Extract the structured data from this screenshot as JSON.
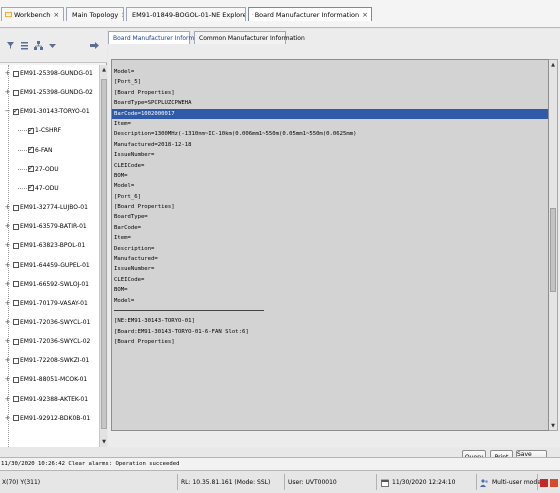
{
  "tabs": [
    {
      "label": "Workbench",
      "icon": "workbench-icon"
    },
    {
      "label": "Main Topology",
      "icon": "topology-icon"
    },
    {
      "label": "EM91-01849-BOGOL-01-NE Explorer]",
      "icon": "ne-explorer-icon"
    },
    {
      "label": "Board Manufacturer Information",
      "icon": "info-icon"
    }
  ],
  "left_toolbar": {
    "icons": [
      "filter-icon",
      "list-icon",
      "tree-icon",
      "dropdown-icon",
      "arrow-right-icon"
    ]
  },
  "tree": {
    "items": [
      {
        "label": "EM91-25398-GUNDG-01",
        "checked": false,
        "level": 0
      },
      {
        "label": "EM91-25398-GUNDG-02",
        "checked": false,
        "level": 0
      },
      {
        "label": "EM91-30143-TORYO-01",
        "checked": true,
        "level": 0
      },
      {
        "label": "1-CSHRF",
        "checked": true,
        "level": 1
      },
      {
        "label": "6-FAN",
        "checked": true,
        "level": 1
      },
      {
        "label": "27-ODU",
        "checked": true,
        "level": 1
      },
      {
        "label": "47-ODU",
        "checked": true,
        "level": 1
      },
      {
        "label": "EM91-32774-LUJBO-01",
        "checked": false,
        "level": 0
      },
      {
        "label": "EM91-63579-BATIR-01",
        "checked": false,
        "level": 0
      },
      {
        "label": "EM91-63823-BPOL-01",
        "checked": false,
        "level": 0
      },
      {
        "label": "EM91-64459-GUPEL-01",
        "checked": false,
        "level": 0
      },
      {
        "label": "EM91-66592-SWLOJ-01",
        "checked": false,
        "level": 0
      },
      {
        "label": "EM91-70179-VASAY-01",
        "checked": false,
        "level": 0
      },
      {
        "label": "EM91-72036-SWYCL-01",
        "checked": false,
        "level": 0
      },
      {
        "label": "EM91-72036-SWYCL-02",
        "checked": false,
        "level": 0
      },
      {
        "label": "EM91-72208-SWKZI-01",
        "checked": false,
        "level": 0
      },
      {
        "label": "EM91-88051-MCOK-01",
        "checked": false,
        "level": 0
      },
      {
        "label": "EM91-92388-AKTEK-01",
        "checked": false,
        "level": 0
      },
      {
        "label": "EM91-92912-BDK0B-01",
        "checked": false,
        "level": 0
      }
    ]
  },
  "subtabs": [
    {
      "label": "Board Manufacturer Information",
      "active": true
    },
    {
      "label": "Common Manufacturer Information",
      "active": false
    }
  ],
  "text_lines": [
    "Model=",
    "[Port_5]",
    "[Board Properties]",
    "BoardType=SPCPLUZCPWEHA",
    "BarCode=1002000017",
    "Item=",
    "Description=1300MHz(-1310nm~IC-10km(0.006mm1~550m(0.05mm1~550m(0.0625mm)",
    "Manufactured=2018-12-18",
    "IssueNumber=",
    "CLEICode=",
    "BOM=",
    "Model=",
    "[Port_6]",
    "[Board Properties]",
    "BoardType=",
    "BarCode=",
    "Item=",
    "Description=",
    "Manufactured=",
    "IssueNumber=",
    "CLEICode=",
    "BOM=",
    "Model=",
    "",
    "[NE:EM91-30143-TORYO-01]",
    "[Board:EM91-30143-TORYO-01-6-FAN Slot:6]",
    "[Board Properties]"
  ],
  "selected_line": 4,
  "buttons": {
    "query": "Query",
    "print": "Print",
    "save": "Save As..."
  },
  "log": "11/30/2020 10:26:42 Clear alarms: Operation succeeded",
  "status": {
    "coords": "X(70) Y(311)",
    "server": "RL: 10.35.81.161 (Mode: SSL)",
    "user": "User: UVT00010",
    "time": "11/30/2020 12:24:10",
    "mode": "Multi-user mode"
  },
  "colors": {
    "selection": "#2f5aa8",
    "tab_text": "#1b3f8f",
    "alarm_red": "#c62828"
  }
}
